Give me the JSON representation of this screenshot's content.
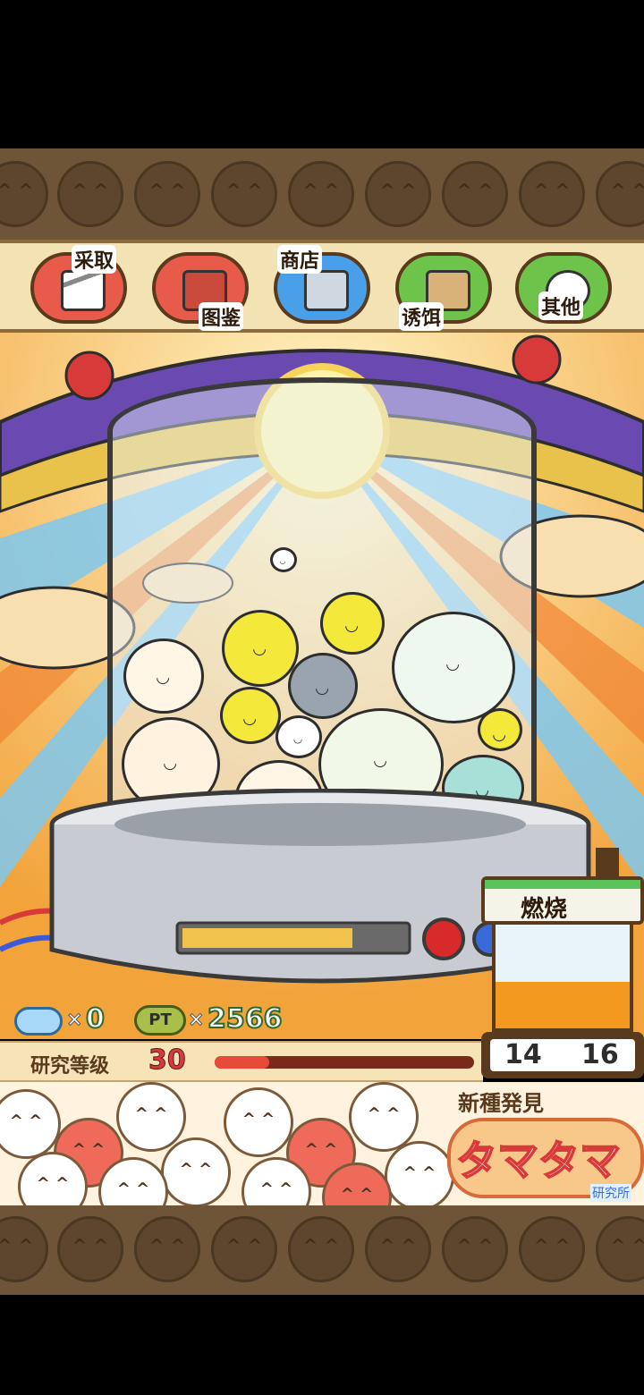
{
  "menu": {
    "items": [
      {
        "label": "采取",
        "icon": "tweezers-icon",
        "color": "#e85a4a"
      },
      {
        "label": "图鉴",
        "icon": "book-icon",
        "color": "#e85a4a"
      },
      {
        "label": "商店",
        "icon": "cart-icon",
        "color": "#4aa0e8"
      },
      {
        "label": "诱饵",
        "icon": "paper-bag-icon",
        "color": "#6ec34a"
      },
      {
        "label": "其他",
        "icon": "tama-face-icon",
        "color": "#6ec34a"
      }
    ]
  },
  "stats": {
    "gems": "0",
    "gem_multiplier": "×",
    "pt_badge": "PT",
    "pt_multiplier": "×",
    "points": "2566"
  },
  "level": {
    "label": "研究等级",
    "value": "30",
    "progress": 0.21
  },
  "burn": {
    "label": "燃烧",
    "current": "14",
    "max": "16",
    "fill_fraction": 0.45
  },
  "banner": {
    "subtitle": "新種発見",
    "title": "タマタマ",
    "tag": "研究所"
  },
  "colors": {
    "frame_brown": "#6e5538",
    "menu_bg": "#f3e3b4",
    "points_green": "#2d6a2d",
    "progress_red": "#d83a3a",
    "gauge_orange": "#f39a1e"
  }
}
